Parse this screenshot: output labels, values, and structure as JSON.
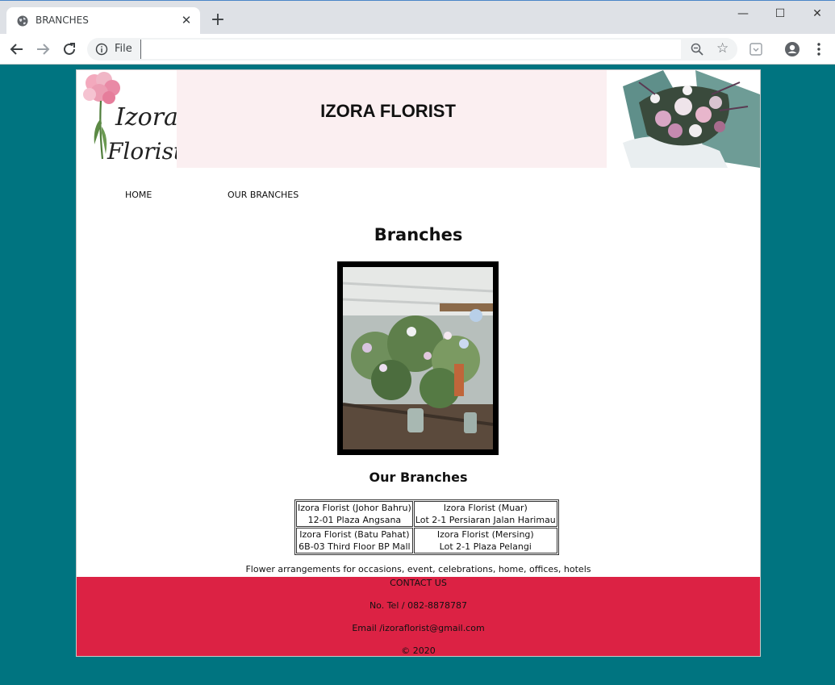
{
  "browser": {
    "tab_title": "BRANCHES",
    "close_symbol": "✕",
    "new_tab_symbol": "+",
    "omnibox_scheme": "File",
    "minimize_symbol": "—",
    "maximize_symbol": "☐",
    "window_close_symbol": "✕",
    "star_symbol": "☆"
  },
  "site": {
    "title": "IZORA FLORIST",
    "logo_text_line1": "Izora",
    "logo_text_line2": "Florist"
  },
  "nav": {
    "home": "HOME",
    "branches": "OUR BRANCHES"
  },
  "main": {
    "heading": "Branches",
    "subheading": "Our Branches",
    "branches": [
      {
        "name": "Izora Florist (Johor Bahru)",
        "address": "12-01 Plaza Angsana"
      },
      {
        "name": "Izora Florist (Muar)",
        "address": "Lot 2-1 Persiaran Jalan Harimau"
      },
      {
        "name": "Izora Florist (Batu Pahat)",
        "address": "6B-03 Third Floor BP Mall"
      },
      {
        "name": "Izora Florist (Mersing)",
        "address": "Lot 2-1 Plaza Pelangi"
      }
    ],
    "tagline": "Flower arrangements for occasions, event, celebrations, home, offices, hotels"
  },
  "footer": {
    "contact": "CONTACT US",
    "phone": "No. Tel / 082-8878787",
    "email": "Email /izoraflorist@gmail.com",
    "copyright": "© 2020"
  },
  "colors": {
    "page_background": "#007480",
    "header_background": "#fbeff1",
    "footer_background": "#dc2244"
  },
  "icons": [
    "globe-icon",
    "back-icon",
    "forward-icon",
    "reload-icon",
    "info-icon",
    "zoom-icon",
    "star-icon",
    "extension-icon",
    "profile-icon",
    "menu-icon"
  ]
}
